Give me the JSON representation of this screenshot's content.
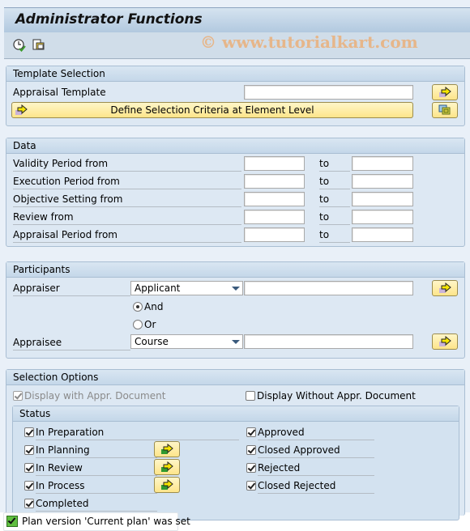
{
  "window": {
    "title": "Administrator Functions",
    "watermark": "© www.tutorialkart.com"
  },
  "toolbar": {
    "buttons": [
      {
        "icon": "execute-clock-icon"
      },
      {
        "icon": "get-variant-icon"
      }
    ]
  },
  "template_selection": {
    "heading": "Template Selection",
    "appraisal_template_label": "Appraisal Template",
    "appraisal_template_value": "",
    "define_criteria_label": "Define Selection Criteria at Element Level"
  },
  "data_section": {
    "heading": "Data",
    "to_label": "to",
    "rows": [
      {
        "label": "Validity Period from",
        "from": "",
        "to": ""
      },
      {
        "label": "Execution Period from",
        "from": "",
        "to": ""
      },
      {
        "label": "Objective Setting from",
        "from": "",
        "to": ""
      },
      {
        "label": "Review from",
        "from": "",
        "to": ""
      },
      {
        "label": "Appraisal Period from",
        "from": "",
        "to": ""
      }
    ]
  },
  "participants": {
    "heading": "Participants",
    "appraiser_label": "Appraiser",
    "appraiser_type": "Applicant",
    "appraiser_value": "",
    "and_label": "And",
    "or_label": "Or",
    "logic_selected": "And",
    "appraisee_label": "Appraisee",
    "appraisee_type": "Course",
    "appraisee_value": ""
  },
  "selection_options": {
    "heading": "Selection Options",
    "display_with_doc": {
      "label": "Display with Appr. Document",
      "checked": true,
      "disabled": true
    },
    "display_without_doc": {
      "label": "Display Without Appr. Document",
      "checked": false
    },
    "status": {
      "heading": "Status",
      "left": [
        {
          "label": "In Preparation",
          "checked": true
        },
        {
          "label": "In Planning",
          "checked": true
        },
        {
          "label": "In Review",
          "checked": true
        },
        {
          "label": "In Process",
          "checked": true
        },
        {
          "label": "Completed",
          "checked": true
        }
      ],
      "right": [
        {
          "label": "Approved",
          "checked": true
        },
        {
          "label": "Closed Approved",
          "checked": true
        },
        {
          "label": "Rejected",
          "checked": true
        },
        {
          "label": "Closed Rejected",
          "checked": true
        }
      ]
    }
  },
  "status_bar": {
    "message": "Plan version 'Current plan' was set",
    "type": "success"
  }
}
